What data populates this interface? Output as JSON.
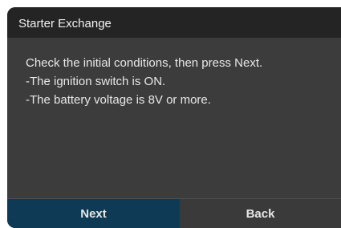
{
  "dialog": {
    "title": "Starter Exchange",
    "lines": [
      "Check the initial conditions, then press Next.",
      "-The ignition switch is ON.",
      "-The battery voltage is 8V or more."
    ],
    "buttons": {
      "next_label": "Next",
      "back_label": "Back"
    }
  },
  "colors": {
    "title_bar": "#242424",
    "body": "#3c3c3c",
    "next_button": "#0e3a55",
    "back_button": "#3a3a3a"
  }
}
